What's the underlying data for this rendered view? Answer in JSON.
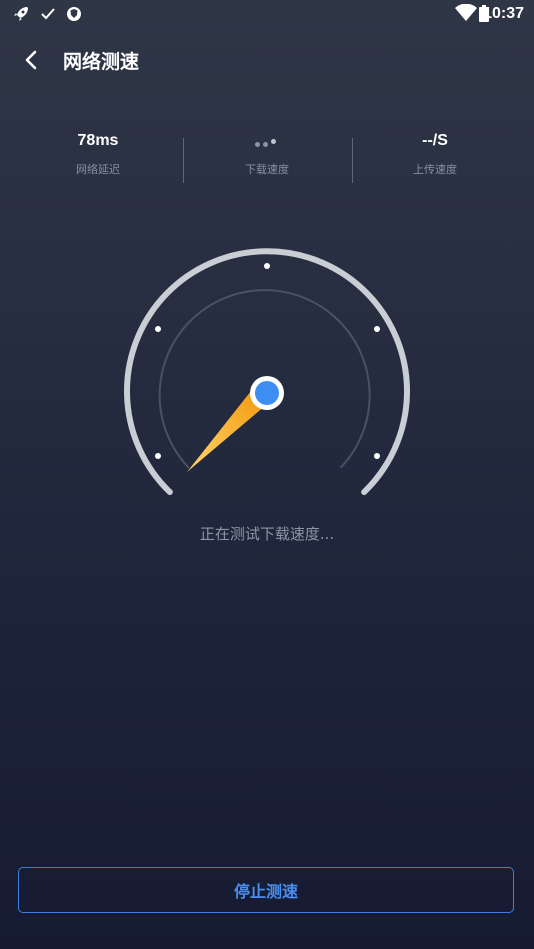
{
  "status_bar": {
    "time": "10:37",
    "icons": [
      "rocket-icon",
      "check-icon",
      "shield-icon",
      "wifi-icon",
      "battery-icon"
    ]
  },
  "header": {
    "title": "网络测速",
    "back_icon": "chevron-left-icon"
  },
  "stats": {
    "latency": {
      "value": "78ms",
      "label": "网络延迟"
    },
    "download": {
      "value": "",
      "label": "下载速度",
      "loading_icon": "loading-dots-icon"
    },
    "upload": {
      "value": "--/S",
      "label": "上传速度"
    }
  },
  "gauge": {
    "needle_color": "#f5a623",
    "hub_color": "#3d8ef2",
    "ring_color": "#c9cdd4"
  },
  "status": {
    "text": "正在测试下载速度..."
  },
  "footer": {
    "stop_label": "停止测速",
    "accent": "#3d7fe0"
  }
}
